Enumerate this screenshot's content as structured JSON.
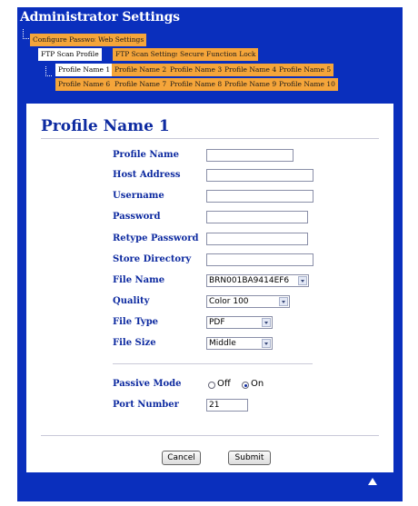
{
  "header": {
    "title": "Administrator Settings"
  },
  "nav": {
    "row1": [
      "Configure Password",
      "Web Settings"
    ],
    "row2": [
      "FTP Scan Profile",
      "FTP Scan Settings",
      "Secure Function Lock"
    ],
    "row3": [
      "Profile Name 1",
      "Profile Name 2",
      "Profile Name 3",
      "Profile Name 4",
      "Profile Name 5"
    ],
    "row4": [
      "Profile Name 6",
      "Profile Name 7",
      "Profile Name 8",
      "Profile Name 9",
      "Profile Name 10"
    ]
  },
  "form": {
    "title": "Profile Name 1",
    "labels": {
      "profile_name": "Profile Name",
      "host_address": "Host Address",
      "username": "Username",
      "password": "Password",
      "retype_password": "Retype Password",
      "store_directory": "Store Directory",
      "file_name": "File Name",
      "quality": "Quality",
      "file_type": "File Type",
      "file_size": "File Size",
      "passive_mode": "Passive Mode",
      "port_number": "Port Number"
    },
    "values": {
      "profile_name": "",
      "host_address": "",
      "username": "",
      "password": "",
      "retype_password": "",
      "store_directory": "",
      "file_name": "BRN001BA9414EF6",
      "quality": "Color 100",
      "file_type": "PDF",
      "file_size": "Middle",
      "port_number": "21"
    },
    "passive_mode": {
      "off_label": "Off",
      "on_label": "On",
      "selected": "On"
    }
  },
  "buttons": {
    "cancel": "Cancel",
    "submit": "Submit"
  },
  "icons": {
    "tree_connector": "tree-connector-icon",
    "scroll_top": "up-arrow-icon"
  },
  "colors": {
    "frame": "#0a2fbd",
    "tab": "#f5a53a",
    "label": "#0d2aa0"
  }
}
